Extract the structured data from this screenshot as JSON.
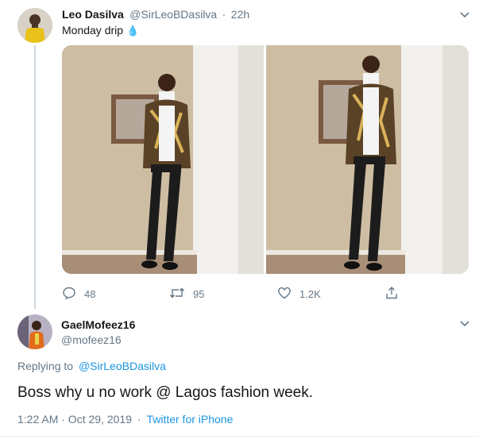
{
  "original_tweet": {
    "author_name": "Leo Dasilva",
    "handle": "@SirLeoBDasilva",
    "separator": "·",
    "time": "22h",
    "text": "Monday drip",
    "emoji": "💧",
    "actions": {
      "replies": "48",
      "retweets": "95",
      "likes": "1.2K"
    }
  },
  "reply_tweet": {
    "author_name": "GaelMofeez16",
    "handle": "@mofeez16",
    "replying_prefix": "Replying to",
    "replying_to": "@SirLeoBDasilva",
    "text": "Boss why u no work @ Lagos fashion week.",
    "timestamp": "1:22 AM · Oct 29, 2019",
    "separator": "·",
    "source": "Twitter for iPhone"
  },
  "colors": {
    "link": "#1b95e0",
    "secondary_text": "#657786",
    "divider": "#e6ecf0",
    "thread_line": "#ccd6dd"
  }
}
